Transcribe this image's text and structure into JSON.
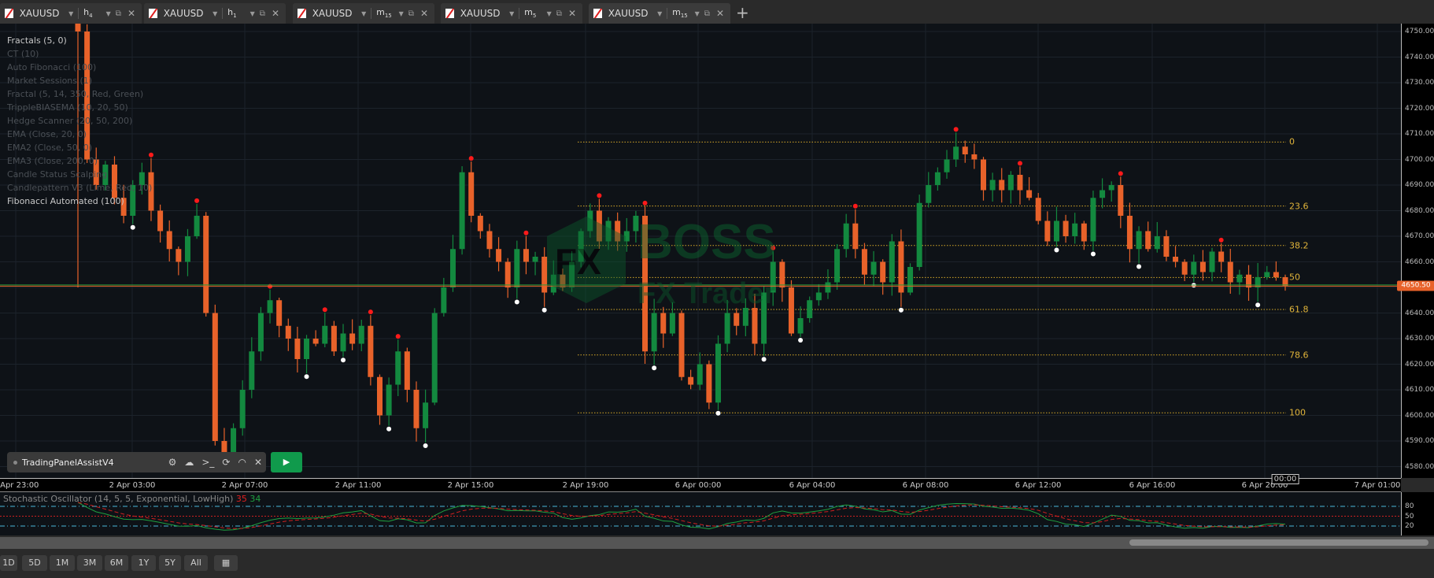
{
  "tabs": [
    {
      "symbol": "XAUUSD",
      "timeframe": "h",
      "timeframe_sub": "4",
      "active": false
    },
    {
      "symbol": "XAUUSD",
      "timeframe": "h",
      "timeframe_sub": "1",
      "active": false
    },
    {
      "symbol": "XAUUSD",
      "timeframe": "m",
      "timeframe_sub": "15",
      "active": false
    },
    {
      "symbol": "XAUUSD",
      "timeframe": "m",
      "timeframe_sub": "5",
      "active": false
    },
    {
      "symbol": "XAUUSD",
      "timeframe": "m",
      "timeframe_sub": "15",
      "active": true
    }
  ],
  "indicators": [
    {
      "label": "Fractals (5, 0)",
      "on": true
    },
    {
      "label": "CT (10)",
      "on": false
    },
    {
      "label": "Auto Fibonacci (100)",
      "on": false
    },
    {
      "label": "Market Sessions (1)",
      "on": false
    },
    {
      "label": "Fractal (5, 14, 350, Red, Green)",
      "on": false
    },
    {
      "label": "TrippleBIASEMA (10, 20, 50)",
      "on": false
    },
    {
      "label": "Hedge Scanner (20, 50, 200)",
      "on": false
    },
    {
      "label": "EMA (Close, 20, 0)",
      "on": false
    },
    {
      "label": "EMA2 (Close, 50, 0)",
      "on": false
    },
    {
      "label": "EMA3 (Close, 200, 0)",
      "on": false
    },
    {
      "label": "Candle Status Scalping",
      "on": false
    },
    {
      "label": "Candlepattern V3 (Lime, Red, 10)",
      "on": false
    },
    {
      "label": "Fibonacci Automated (100)",
      "on": true
    }
  ],
  "watermark": {
    "logo": "FX",
    "line1": "BOSS",
    "line2": "FX Trader"
  },
  "colors": {
    "bull": "#13893f",
    "bear": "#e8622a",
    "fib": "#d7a928",
    "fractal_high": "#ff1a1a",
    "fractal_low": "#ffffff",
    "bg": "#0e1217"
  },
  "price_axis": {
    "labels": [
      "4750.00",
      "4740.00",
      "4730.00",
      "4720.00",
      "4710.00",
      "4700.00",
      "4690.00",
      "4680.00",
      "4670.00",
      "4660.00",
      "4650.00",
      "4640.00",
      "4630.00",
      "4620.00",
      "4610.00",
      "4600.00",
      "4590.00",
      "4580.00"
    ],
    "current_price": "4650.50"
  },
  "time_axis": {
    "labels": [
      "1 Apr 23:00",
      "2 Apr 03:00",
      "2 Apr 07:00",
      "2 Apr 11:00",
      "2 Apr 15:00",
      "2 Apr 19:00",
      "6 Apr 00:00",
      "6 Apr 04:00",
      "6 Apr 08:00",
      "6 Apr 12:00",
      "6 Apr 16:00",
      "6 Apr 20:00",
      "7 Apr 01:00"
    ],
    "cursor_label": "00:00"
  },
  "fibonacci": {
    "levels": [
      {
        "label": "0",
        "price": 4706.8
      },
      {
        "label": "23.6",
        "price": 4681.8
      },
      {
        "label": "38.2",
        "price": 4666.4
      },
      {
        "label": "50",
        "price": 4653.9
      },
      {
        "label": "61.8",
        "price": 4641.4
      },
      {
        "label": "78.6",
        "price": 4623.6
      },
      {
        "label": "100",
        "price": 4601.0
      }
    ]
  },
  "chart_data": {
    "type": "candlestick",
    "symbol": "XAUUSD",
    "closes": [
      4750,
      4700,
      4690,
      4698,
      4685,
      4678,
      4690,
      4695,
      4680,
      4672,
      4665,
      4660,
      4670,
      4678,
      4640,
      4590,
      4585,
      4595,
      4610,
      4625,
      4640,
      4645,
      4635,
      4630,
      4622,
      4630,
      4628,
      4635,
      4625,
      4632,
      4628,
      4635,
      4615,
      4600,
      4612,
      4625,
      4610,
      4595,
      4605,
      4640,
      4650,
      4665,
      4695,
      4678,
      4672,
      4665,
      4660,
      4650,
      4665,
      4660,
      4662,
      4648,
      4655,
      4650,
      4660,
      4672,
      4680,
      4668,
      4676,
      4668,
      4672,
      4678,
      4625,
      4640,
      4632,
      4640,
      4615,
      4612,
      4620,
      4605,
      4628,
      4640,
      4635,
      4642,
      4628,
      4648,
      4660,
      4650,
      4632,
      4638,
      4645,
      4648,
      4652,
      4665,
      4675,
      4665,
      4655,
      4660,
      4652,
      4668,
      4648,
      4658,
      4683,
      4690,
      4695,
      4700,
      4705,
      4702,
      4700,
      4688,
      4692,
      4688,
      4694,
      4688,
      4685,
      4676,
      4668,
      4676,
      4670,
      4675,
      4668,
      4685,
      4688,
      4690,
      4678,
      4665,
      4672,
      4665,
      4670,
      4662,
      4660,
      4655,
      4660,
      4656,
      4664,
      4660,
      4652,
      4655,
      4650,
      4654,
      4656,
      4654,
      4650.5
    ],
    "ylim": [
      4575,
      4755
    ]
  },
  "stochastic": {
    "title": "Stochastic Oscillator (14, 5, 5, Exponential, LowHigh)",
    "k": "35",
    "d": "34",
    "levels": [
      "80",
      "50",
      "20"
    ]
  },
  "trading_panel": {
    "title": "TradingPanelAssistV4"
  },
  "range_buttons": [
    "1D",
    "5D",
    "1M",
    "3M",
    "6M",
    "1Y",
    "5Y",
    "All"
  ]
}
